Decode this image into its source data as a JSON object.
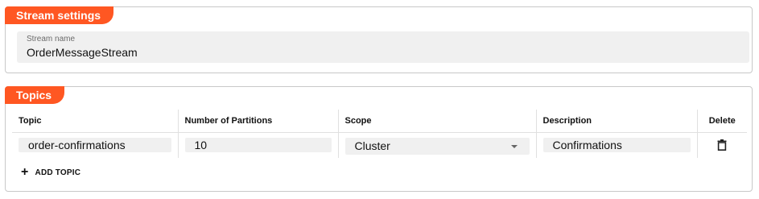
{
  "stream_settings": {
    "title": "Stream settings",
    "stream_name": {
      "label": "Stream name",
      "value": "OrderMessageStream"
    }
  },
  "topics": {
    "title": "Topics",
    "columns": [
      "Topic",
      "Number of Partitions",
      "Scope",
      "Description",
      "Delete"
    ],
    "rows": [
      {
        "topic": "order-confirmations",
        "partitions": "10",
        "scope": "Cluster",
        "description": "Confirmations"
      }
    ],
    "add_topic_label": "ADD TOPIC",
    "icons": {
      "delete": "trash-icon",
      "add": "plus-icon",
      "dropdown": "chevron-down-icon"
    }
  },
  "colors": {
    "accent": "#ff5722",
    "field_bg": "#f0f0f0",
    "border": "#c8c8c8"
  }
}
